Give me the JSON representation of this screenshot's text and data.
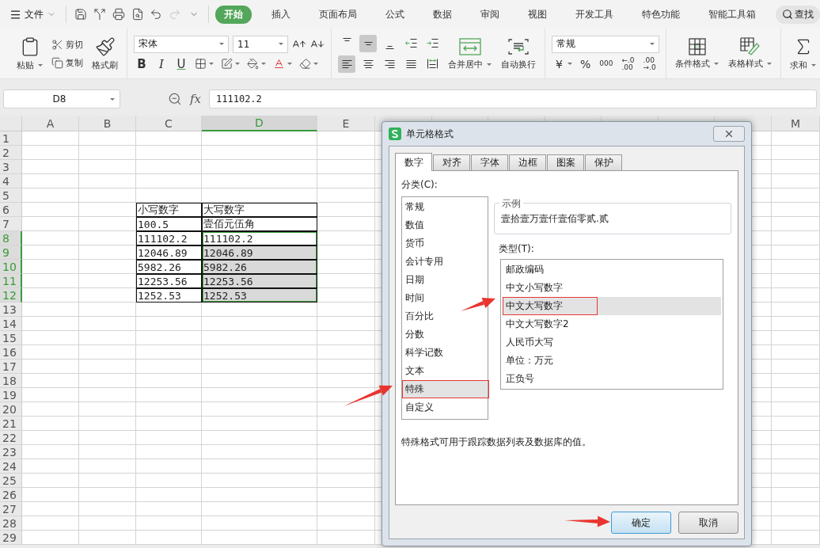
{
  "menu_bar": {
    "file": "文件",
    "quick_access": [
      {
        "kind": "save",
        "disabled": false
      },
      {
        "kind": "convert",
        "disabled": false
      },
      {
        "kind": "print",
        "disabled": false
      },
      {
        "kind": "preview",
        "disabled": false
      },
      {
        "kind": "undo",
        "disabled": false
      },
      {
        "kind": "redo",
        "disabled": true
      },
      {
        "kind": "more",
        "disabled": false
      }
    ],
    "tabs": [
      {
        "label": "开始",
        "selected": true
      },
      {
        "label": "插入",
        "selected": false
      },
      {
        "label": "页面布局",
        "selected": false
      },
      {
        "label": "公式",
        "selected": false
      },
      {
        "label": "数据",
        "selected": false
      },
      {
        "label": "审阅",
        "selected": false
      },
      {
        "label": "视图",
        "selected": false
      },
      {
        "label": "开发工具",
        "selected": false
      },
      {
        "label": "特色功能",
        "selected": false
      },
      {
        "label": "智能工具箱",
        "selected": false
      }
    ],
    "search": "查找"
  },
  "ribbon": {
    "clipboard": {
      "paste": "粘贴",
      "cut": "剪切",
      "copy": "复制",
      "format_painter": "格式刷"
    },
    "font": {
      "name": "宋体",
      "size": "11",
      "styles": [
        {
          "kind": "bold",
          "label": "B"
        },
        {
          "kind": "italic",
          "label": "I"
        },
        {
          "kind": "underline",
          "label": "U"
        }
      ]
    },
    "alignment": {
      "top_row": [
        {
          "kind": "top",
          "selected": false
        },
        {
          "kind": "middle",
          "selected": true
        },
        {
          "kind": "bottom",
          "selected": false
        },
        {
          "kind": "outdent",
          "selected": false
        },
        {
          "kind": "indent",
          "selected": false
        }
      ],
      "bottom_row": [
        {
          "kind": "left",
          "selected": true
        },
        {
          "kind": "center",
          "selected": false
        },
        {
          "kind": "right",
          "selected": false
        },
        {
          "kind": "justify",
          "selected": false
        },
        {
          "kind": "distribute",
          "selected": false
        }
      ],
      "merge": "合并居中",
      "wrap": "自动换行"
    },
    "number": {
      "format": "常规",
      "currency": "¥",
      "percent": "%",
      "thousands": "000",
      "increase_decimal": [
        "←.0",
        ".00"
      ],
      "decrease_decimal": [
        ".00",
        "→.0"
      ]
    },
    "styles": {
      "conditional": "条件格式",
      "table": "表格样式"
    },
    "sum": "求和"
  },
  "formula_bar": {
    "cell": "D8",
    "fx": "fx",
    "value": "111102.2"
  },
  "sheet": {
    "columns": [
      {
        "letter": "A",
        "selected": false
      },
      {
        "letter": "B",
        "selected": false
      },
      {
        "letter": "C",
        "selected": false
      },
      {
        "letter": "D",
        "selected": true
      },
      {
        "letter": "E",
        "selected": false
      },
      {
        "letter": "M",
        "selected": false
      }
    ],
    "rows": [
      {
        "number": "1",
        "selected": false
      },
      {
        "number": "2",
        "selected": false
      },
      {
        "number": "3",
        "selected": false
      },
      {
        "number": "4",
        "selected": false
      },
      {
        "number": "5",
        "selected": false
      },
      {
        "number": "6",
        "selected": false,
        "C": "小写数字",
        "D": "大写数字"
      },
      {
        "number": "7",
        "selected": false,
        "C": "100.5",
        "D": "壹佰元伍角"
      },
      {
        "number": "8",
        "selected": true,
        "C": "111102.2",
        "D": "111102.2"
      },
      {
        "number": "9",
        "selected": true,
        "C": "12046.89",
        "D": "12046.89"
      },
      {
        "number": "10",
        "selected": true,
        "C": "5982.26",
        "D": "5982.26"
      },
      {
        "number": "11",
        "selected": true,
        "C": "12253.56",
        "D": "12253.56"
      },
      {
        "number": "12",
        "selected": true,
        "C": "1252.53",
        "D": "1252.53"
      },
      {
        "number": "13",
        "selected": false
      },
      {
        "number": "14",
        "selected": false
      },
      {
        "number": "15",
        "selected": false
      },
      {
        "number": "16",
        "selected": false
      },
      {
        "number": "17",
        "selected": false
      },
      {
        "number": "18",
        "selected": false
      },
      {
        "number": "19",
        "selected": false
      },
      {
        "number": "20",
        "selected": false
      },
      {
        "number": "21",
        "selected": false
      },
      {
        "number": "22",
        "selected": false
      },
      {
        "number": "23",
        "selected": false
      },
      {
        "number": "24",
        "selected": false
      },
      {
        "number": "25",
        "selected": false
      },
      {
        "number": "26",
        "selected": false
      },
      {
        "number": "27",
        "selected": false
      },
      {
        "number": "28",
        "selected": false
      },
      {
        "number": "29",
        "selected": false
      }
    ]
  },
  "dialog": {
    "title": "单元格格式",
    "tabs": [
      {
        "label": "数字",
        "selected": true
      },
      {
        "label": "对齐",
        "selected": false
      },
      {
        "label": "字体",
        "selected": false
      },
      {
        "label": "边框",
        "selected": false
      },
      {
        "label": "图案",
        "selected": false
      },
      {
        "label": "保护",
        "selected": false
      }
    ],
    "category_label": "分类(C):",
    "categories": [
      {
        "label": "常规",
        "selected": false,
        "highlighted": false
      },
      {
        "label": "数值",
        "selected": false,
        "highlighted": false
      },
      {
        "label": "货币",
        "selected": false,
        "highlighted": false
      },
      {
        "label": "会计专用",
        "selected": false,
        "highlighted": false
      },
      {
        "label": "日期",
        "selected": false,
        "highlighted": false
      },
      {
        "label": "时间",
        "selected": false,
        "highlighted": false
      },
      {
        "label": "百分比",
        "selected": false,
        "highlighted": false
      },
      {
        "label": "分数",
        "selected": false,
        "highlighted": false
      },
      {
        "label": "科学记数",
        "selected": false,
        "highlighted": false
      },
      {
        "label": "文本",
        "selected": false,
        "highlighted": false
      },
      {
        "label": "特殊",
        "selected": true,
        "highlighted": true
      },
      {
        "label": "自定义",
        "selected": false,
        "highlighted": false
      }
    ],
    "sample_label": "示例",
    "sample": "壹拾壹万壹仟壹佰零贰.贰",
    "type_label": "类型(T):",
    "types": [
      {
        "label": "邮政编码",
        "selected": false,
        "highlighted": false
      },
      {
        "label": "中文小写数字",
        "selected": false,
        "highlighted": false
      },
      {
        "label": "中文大写数字",
        "selected": true,
        "highlighted": true
      },
      {
        "label": "中文大写数字2",
        "selected": false,
        "highlighted": false
      },
      {
        "label": "人民币大写",
        "selected": false,
        "highlighted": false
      },
      {
        "label": "单位：万元",
        "selected": false,
        "highlighted": false
      },
      {
        "label": "正负号",
        "selected": false,
        "highlighted": false
      }
    ],
    "description": "特殊格式可用于跟踪数据列表及数据库的值。",
    "buttons": [
      {
        "label": "确定",
        "kind": "primary"
      },
      {
        "label": "取消",
        "kind": "secondary"
      }
    ]
  }
}
